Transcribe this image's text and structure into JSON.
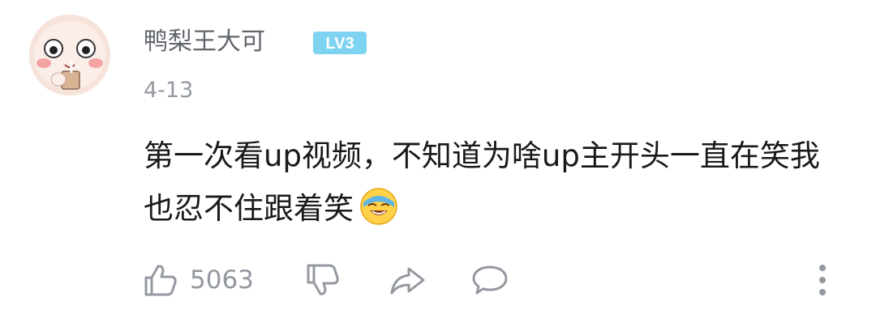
{
  "comment": {
    "username": "鸭梨王大可",
    "level": "LV3",
    "date": "4-13",
    "text": "第一次看up视频，不知道为啥up主开头一直在笑我也忍不住跟着笑",
    "emoji": "laughing-emoji",
    "like_count": "5063"
  },
  "icons": {
    "like": "thumbs-up-icon",
    "dislike": "thumbs-down-icon",
    "share": "share-icon",
    "reply": "reply-icon",
    "more": "more-vertical-icon"
  },
  "colors": {
    "username": "#61666d",
    "level_badge": "#7dd3f0",
    "meta": "#9499a0",
    "text": "#18191c"
  }
}
